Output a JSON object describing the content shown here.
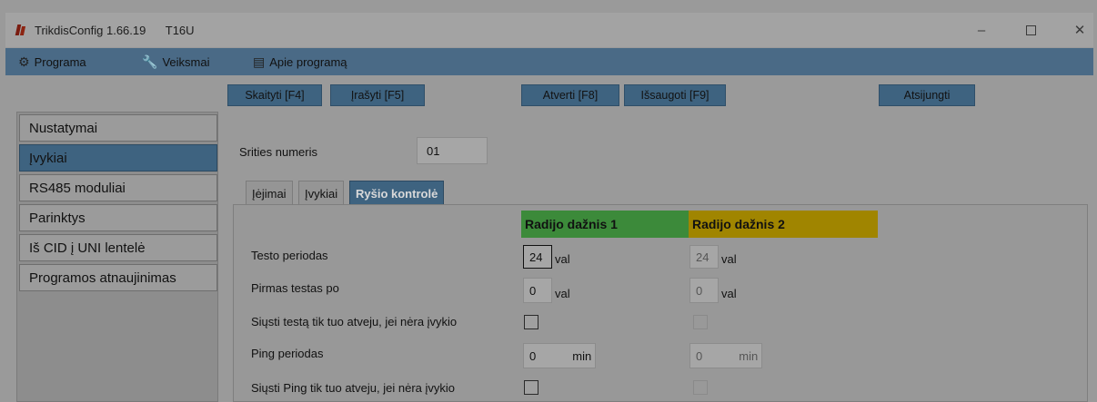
{
  "window": {
    "app_name": "TrikdisConfig 1.66.19",
    "device": "T16U",
    "minimize_glyph": "–",
    "close_glyph": "✕",
    "app_icon": "trikdis-logo-icon"
  },
  "menu": {
    "programa": "Programa",
    "veiksmai": "Veiksmai",
    "apie": "Apie programą",
    "programa_icon": "gear-icon",
    "veiksmai_icon": "wrench-icon",
    "apie_icon": "info-icon"
  },
  "toolbar": {
    "skaityti": "Skaityti [F4]",
    "irasyti": "Įrašyti [F5]",
    "atverti": "Atverti [F8]",
    "issaugoti": "Išsaugoti [F9]",
    "atsijungti": "Atsijungti"
  },
  "sidebar": {
    "items": [
      {
        "label": "Nustatymai",
        "active": false
      },
      {
        "label": "Įvykiai",
        "active": true
      },
      {
        "label": "RS485 moduliai",
        "active": false
      },
      {
        "label": "Parinktys",
        "active": false
      },
      {
        "label": "Iš CID į UNI lentelė",
        "active": false
      },
      {
        "label": "Programos atnaujinimas",
        "active": false
      }
    ]
  },
  "area": {
    "label": "Srities numeris",
    "value": "01"
  },
  "tabs": [
    {
      "label": "Įėjimai",
      "active": false
    },
    {
      "label": "Įvykiai",
      "active": false
    },
    {
      "label": "Ryšio kontrolė",
      "active": true
    }
  ],
  "table": {
    "col1_header": "Radijo dažnis 1",
    "col2_header": "Radijo dažnis 2",
    "colors": {
      "col1": "#3c8a3a",
      "col2": "#a08500"
    },
    "rows": [
      {
        "label": "Testo periodas",
        "v1": "24",
        "u1": "val",
        "v2": "24",
        "u2": "val"
      },
      {
        "label": "Pirmas testas po",
        "v1": "0",
        "u1": "val",
        "v2": "0",
        "u2": "val"
      },
      {
        "label": "Siųsti testą tik tuo atveju, jei nėra įvykio",
        "check1": false,
        "check2": false
      },
      {
        "label": "Ping periodas",
        "v1": "0",
        "u1": "min",
        "v2": "0",
        "u2": "min"
      },
      {
        "label": "Siųsti Ping tik tuo atveju, jei nėra įvykio",
        "check1": false,
        "check2": false
      }
    ]
  }
}
